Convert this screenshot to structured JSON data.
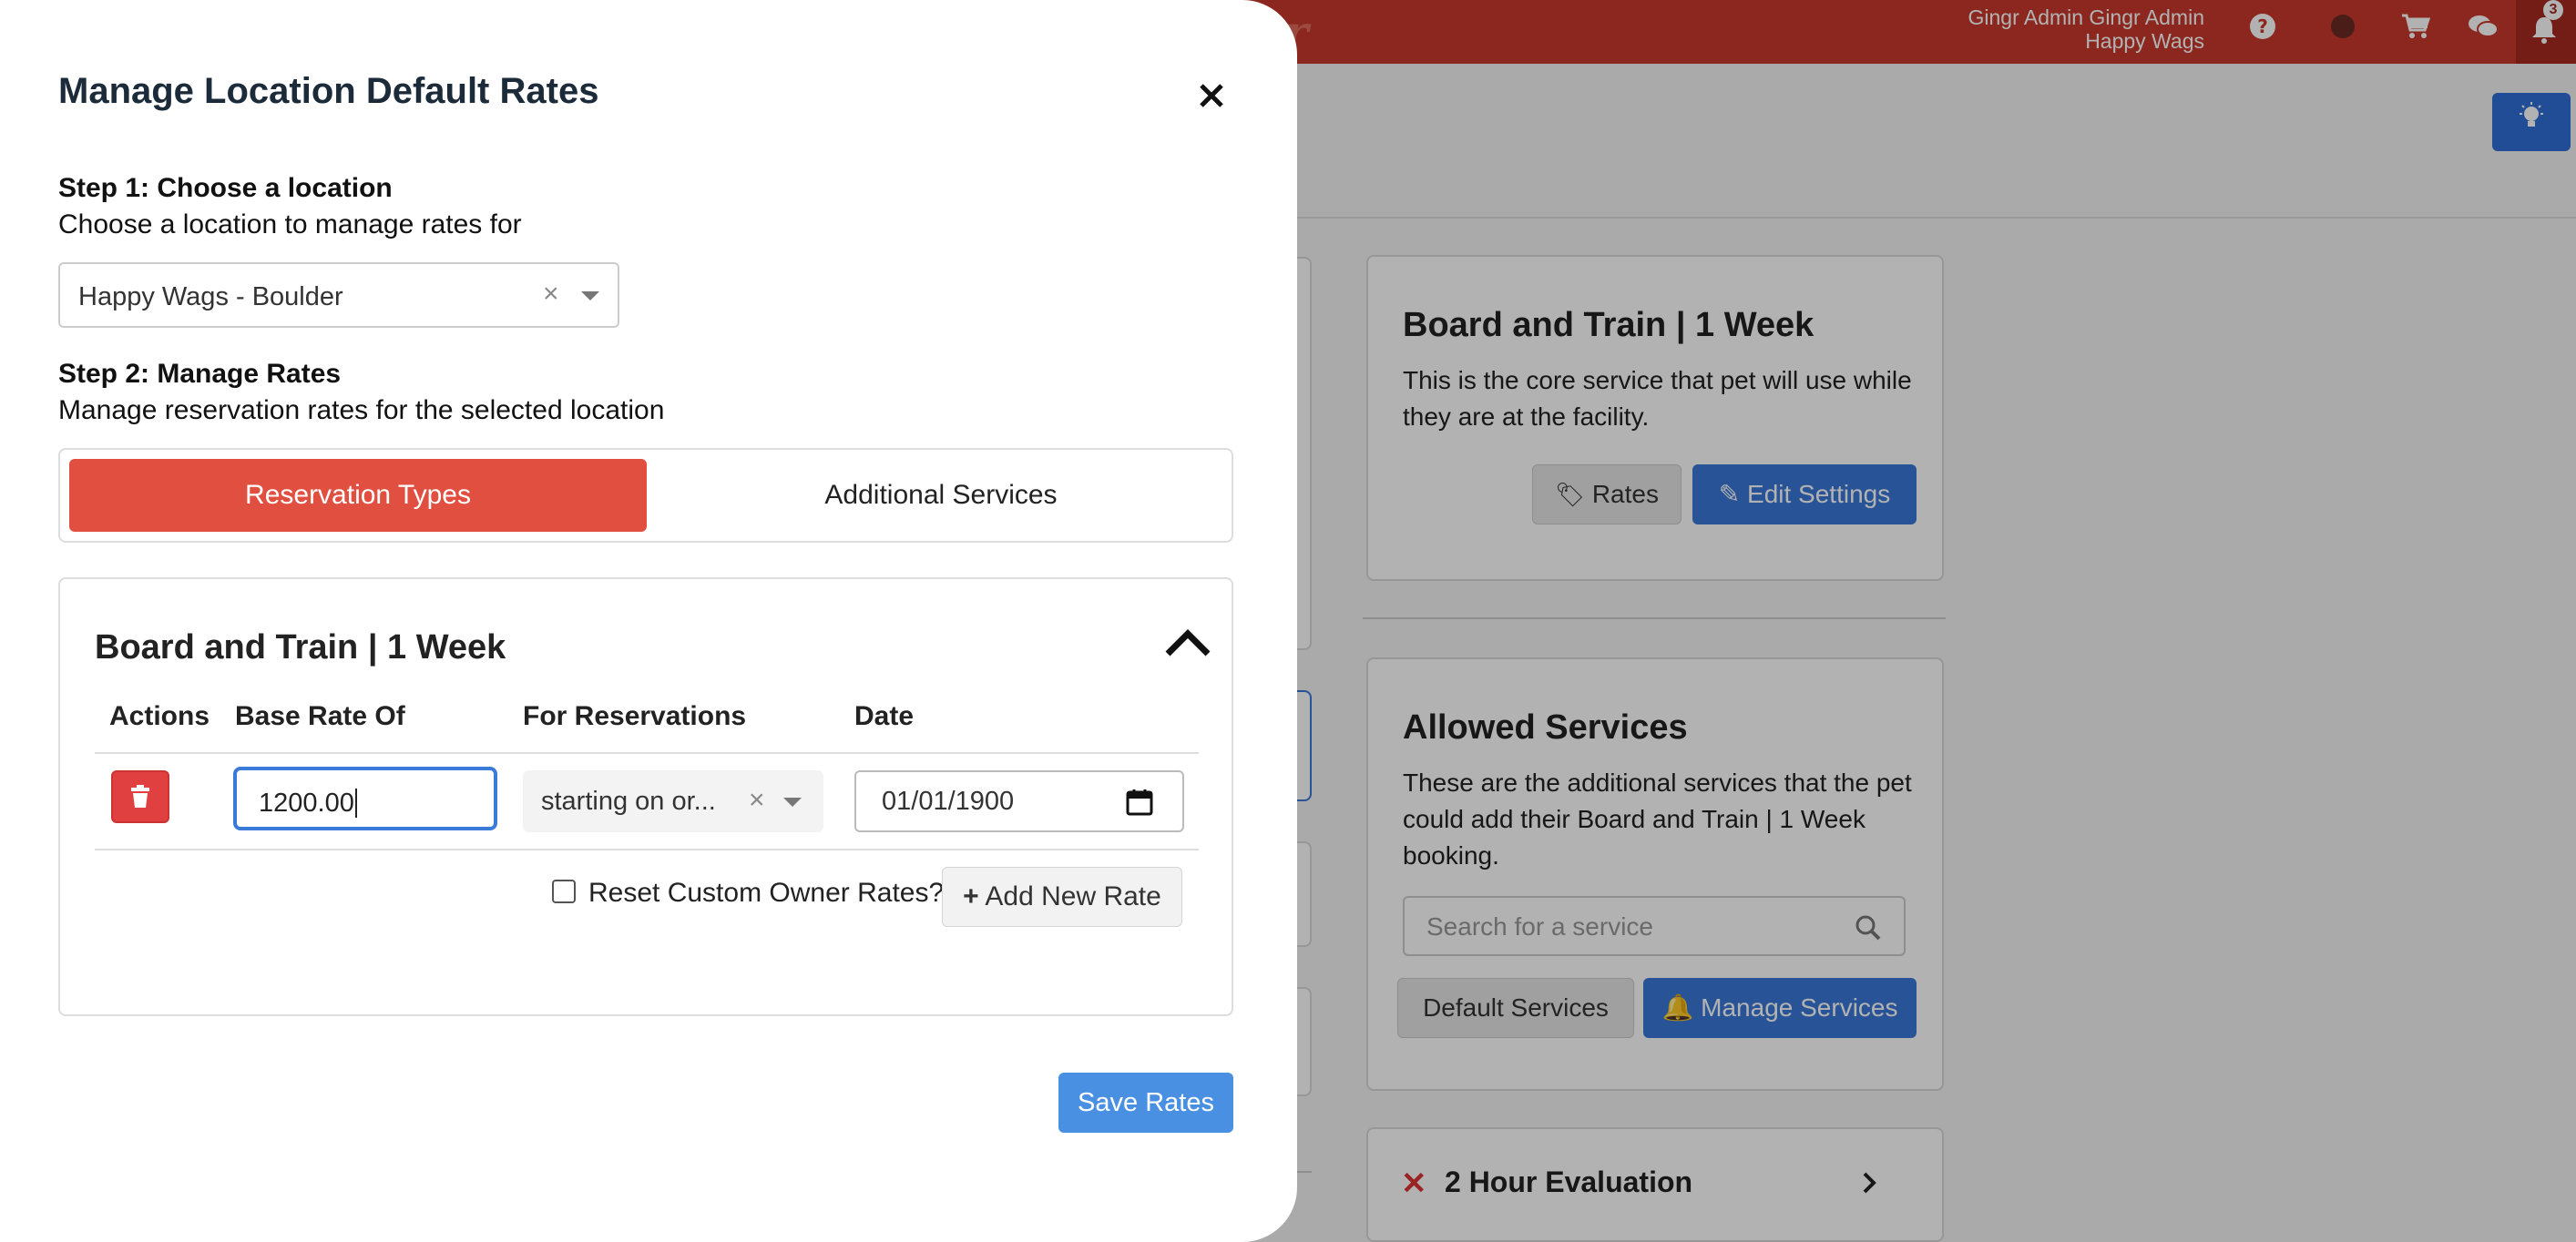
{
  "header": {
    "brand": "gr",
    "user_name": "Gingr Admin Gingr Admin",
    "business": "Happy Wags",
    "notification_count": "3"
  },
  "background_cards": {
    "service_card": {
      "title": "Board and Train | 1 Week",
      "description": "This is the core service that pet will use while they are at the facility.",
      "rates_label": "Rates",
      "edit_label": "Edit Settings"
    },
    "allowed_services": {
      "title": "Allowed Services",
      "description": "These are the additional services that the pet could add their Board and Train | 1 Week booking.",
      "search_placeholder": "Search for a service",
      "default_label": "Default Services",
      "manage_label": "Manage Services"
    },
    "evaluation_item": {
      "label": "2 Hour Evaluation"
    }
  },
  "modal": {
    "title": "Manage Location Default Rates",
    "close_symbol": "×",
    "step1": {
      "heading": "Step 1: Choose a location",
      "subheading": "Choose a location to manage rates for",
      "selected_location": "Happy Wags - Boulder",
      "clear_symbol": "×"
    },
    "step2": {
      "heading": "Step 2: Manage Rates",
      "subheading": "Manage reservation rates for the selected location"
    },
    "tabs": [
      {
        "label": "Reservation Types",
        "active": true
      },
      {
        "label": "Additional Services",
        "active": false
      }
    ],
    "rates_panel": {
      "title": "Board and Train | 1 Week",
      "columns": [
        "Actions",
        "Base Rate Of",
        "For Reservations",
        "Date"
      ],
      "rows": [
        {
          "base_rate": "1200.00",
          "for_reservations": "starting on or...",
          "date": "01/01/1900"
        }
      ],
      "reset_label": "Reset Custom Owner Rates?",
      "reset_checked": false,
      "add_rate_label": "Add New Rate"
    },
    "save_label": "Save Rates"
  },
  "colors": {
    "topbar": "#c8392b",
    "tab_active": "#e04f3f",
    "primary_blue": "#3a78d8",
    "save_blue": "#4a90e2",
    "delete_red": "#e04040"
  }
}
